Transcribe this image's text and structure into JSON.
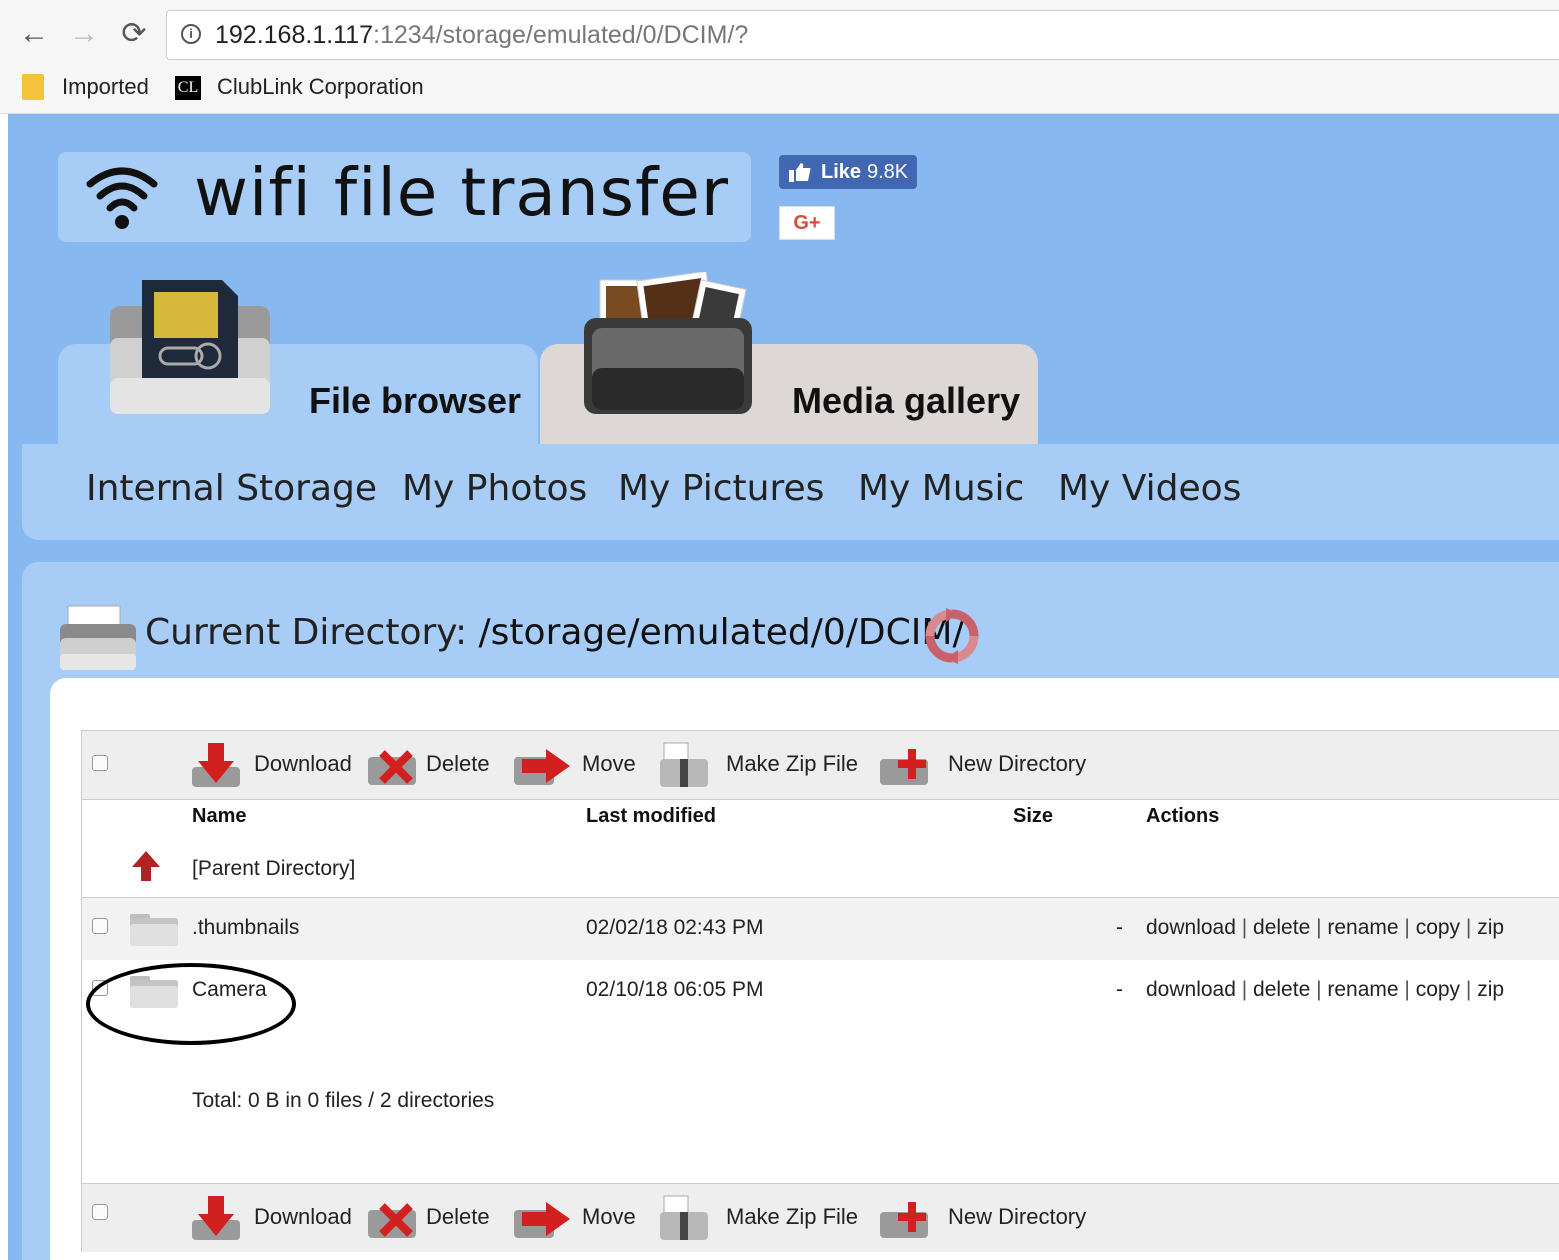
{
  "browser": {
    "url_host": "192.168.1.117",
    "url_rest": ":1234/storage/emulated/0/DCIM/?",
    "bookmarks": [
      "Imported",
      "ClubLink Corporation"
    ],
    "cl_icon_text": "CL"
  },
  "app": {
    "title": "wifi file transfer",
    "fb_like_label": "Like",
    "fb_like_count": "9.8K",
    "gplus_label": "G+"
  },
  "tabs": {
    "file_browser": "File browser",
    "media_gallery": "Media gallery"
  },
  "subnav": [
    "Internal Storage",
    "My Photos",
    "My Pictures",
    "My Music",
    "My Videos"
  ],
  "current_directory": {
    "label": "Current Directory:",
    "path": "/storage/emulated/0/DCIM/"
  },
  "toolbar": {
    "download": "Download",
    "delete": "Delete",
    "move": "Move",
    "make_zip": "Make Zip File",
    "new_directory": "New Directory"
  },
  "table": {
    "headers": {
      "name": "Name",
      "last_modified": "Last modified",
      "size": "Size",
      "actions": "Actions"
    },
    "parent_directory": "[Parent Directory]",
    "rows": [
      {
        "name": ".thumbnails",
        "modified": "02/02/18 02:43 PM",
        "size": "-"
      },
      {
        "name": "Camera",
        "modified": "02/10/18 06:05 PM",
        "size": "-"
      }
    ],
    "actions": [
      "download",
      "delete",
      "rename",
      "copy",
      "zip"
    ],
    "total": "Total: 0 B in 0 files / 2 directories"
  },
  "colors": {
    "page_bg": "#87b9f0",
    "panel_bg": "#a7cdf6",
    "facebook": "#4267b2",
    "gplus_red": "#dd4b39"
  }
}
